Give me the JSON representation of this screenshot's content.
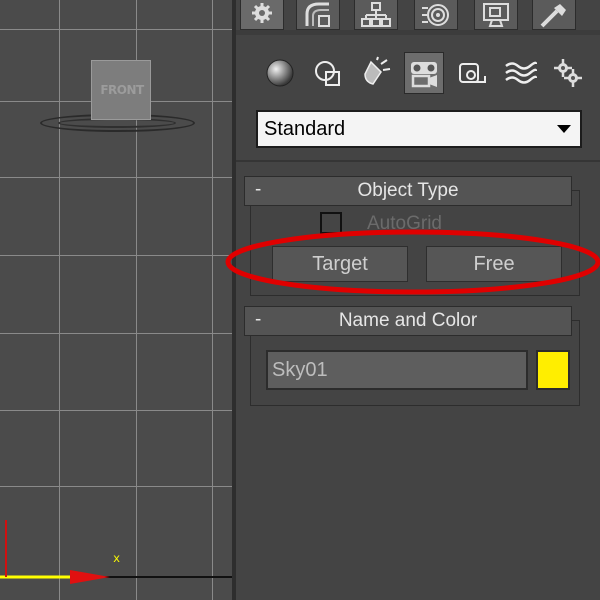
{
  "viewport": {
    "viewcube_label": "FRONT",
    "axis_x_label": "x"
  },
  "command_panel": {
    "tabs": [
      {
        "icon": "create-icon",
        "active": true
      },
      {
        "icon": "modify-icon"
      },
      {
        "icon": "hierarchy-icon"
      },
      {
        "icon": "motion-icon"
      },
      {
        "icon": "display-icon"
      },
      {
        "icon": "utilities-icon"
      }
    ],
    "categories": [
      {
        "icon": "geometry-icon"
      },
      {
        "icon": "shapes-icon"
      },
      {
        "icon": "lights-icon"
      },
      {
        "icon": "cameras-icon",
        "active": true
      },
      {
        "icon": "helpers-icon"
      },
      {
        "icon": "space-warps-icon"
      },
      {
        "icon": "systems-icon"
      }
    ],
    "type_dropdown": {
      "value": "Standard"
    },
    "object_type": {
      "collapse": "-",
      "title": "Object Type",
      "autogrid_label": "AutoGrid",
      "buttons": [
        "Target",
        "Free"
      ]
    },
    "name_and_color": {
      "collapse": "-",
      "title": "Name and Color",
      "name_value": "Sky01",
      "color": "#ffee00"
    }
  },
  "colors": {
    "annotation": "#e00000",
    "axis_x": "#ffff00",
    "axis_arrow": "#e01010"
  }
}
